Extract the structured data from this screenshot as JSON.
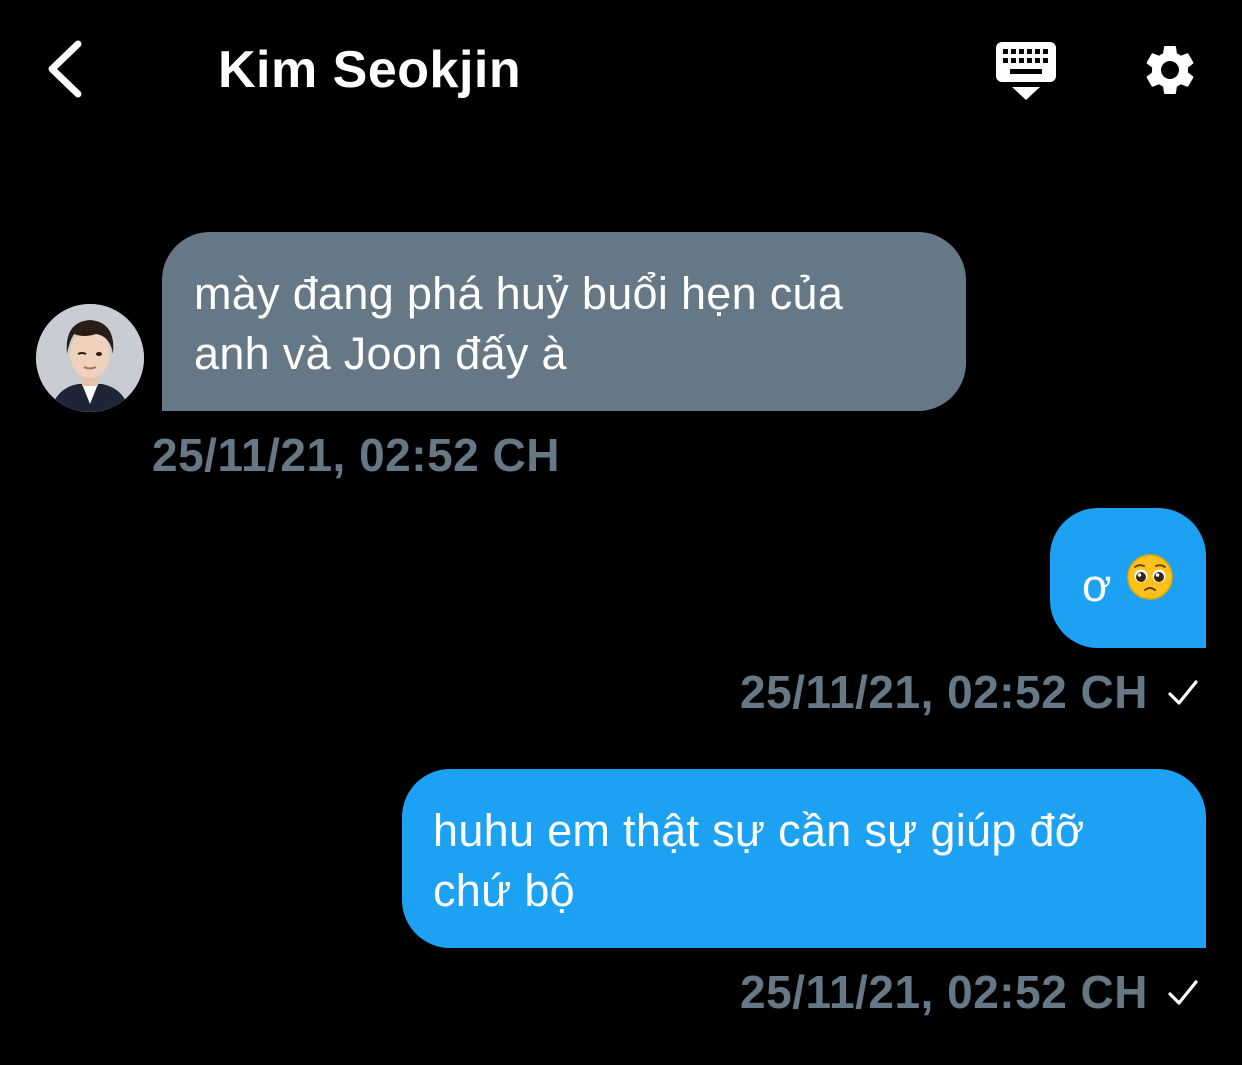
{
  "header": {
    "back_icon": "chevron-left-icon",
    "title": "Kim Seokjin",
    "keyboard_icon": "keyboard-hide-icon",
    "settings_icon": "gear-icon"
  },
  "messages": [
    {
      "direction": "incoming",
      "text_lines": [
        "mày đang phá huỷ buổi hẹn của",
        "anh và Joon đấy à"
      ],
      "timestamp": "25/11/21, 02:52 CH",
      "has_avatar": true
    },
    {
      "direction": "outgoing",
      "text": "ơ",
      "emoji": "pleading-face-emoji",
      "timestamp": "25/11/21, 02:52 CH",
      "status_icon": "checkmark-icon"
    },
    {
      "direction": "outgoing",
      "text_lines": [
        "huhu em thật sự cần sự giúp đỡ",
        "chứ bộ"
      ],
      "timestamp": "25/11/21, 02:52 CH",
      "status_icon": "checkmark-icon"
    }
  ],
  "colors": {
    "background": "#000000",
    "incoming_bubble": "#667785",
    "outgoing_bubble": "#1da1f2",
    "timestamp_text": "#667785",
    "text": "#ffffff"
  }
}
